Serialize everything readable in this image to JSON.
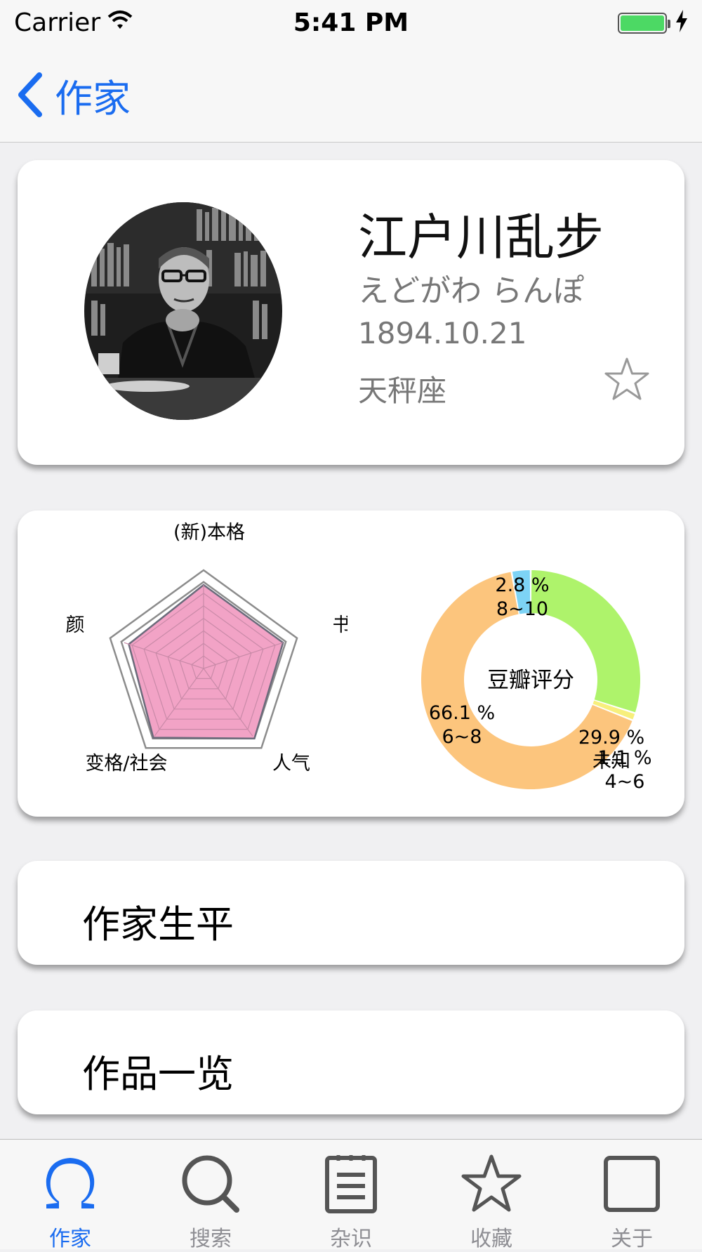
{
  "status_bar": {
    "carrier": "Carrier",
    "time": "5:41 PM"
  },
  "nav": {
    "back_label": "作家"
  },
  "profile": {
    "name": "江户川乱步",
    "kana": "えどがわ らんぽ",
    "birth_date": "1894.10.21",
    "zodiac": "天秤座",
    "favorite": false
  },
  "radar": {
    "axes": [
      "(新)本格",
      "书",
      "人气",
      "变格/社会",
      "颜"
    ],
    "values": [
      0.85,
      0.85,
      0.88,
      0.87,
      0.8
    ]
  },
  "chart_data": {
    "type": "pie",
    "title": "豆瓣评分",
    "slices": [
      {
        "label": "未知",
        "value": 29.9,
        "value_text": "29.9 %",
        "color": "#aef36b"
      },
      {
        "label": "4~6",
        "value": 1.1,
        "value_text": "1.1 %",
        "color": "#f7ef7c"
      },
      {
        "label": "6~8",
        "value": 66.1,
        "value_text": "66.1 %",
        "color": "#fcc57d"
      },
      {
        "label": "8~10",
        "value": 2.8,
        "value_text": "2.8 %",
        "color": "#7dd3f5"
      }
    ]
  },
  "menu": {
    "biography": "作家生平",
    "works": "作品一览"
  },
  "tabs": [
    {
      "label": "作家",
      "icon": "author-icon",
      "active": true
    },
    {
      "label": "搜索",
      "icon": "search-icon",
      "active": false
    },
    {
      "label": "杂识",
      "icon": "notes-icon",
      "active": false
    },
    {
      "label": "收藏",
      "icon": "star-icon",
      "active": false
    },
    {
      "label": "关于",
      "icon": "square-icon",
      "active": false
    }
  ],
  "colors": {
    "accent": "#1a6cf0",
    "radar_fill": "#f19ec3",
    "battery": "#4cd964"
  }
}
